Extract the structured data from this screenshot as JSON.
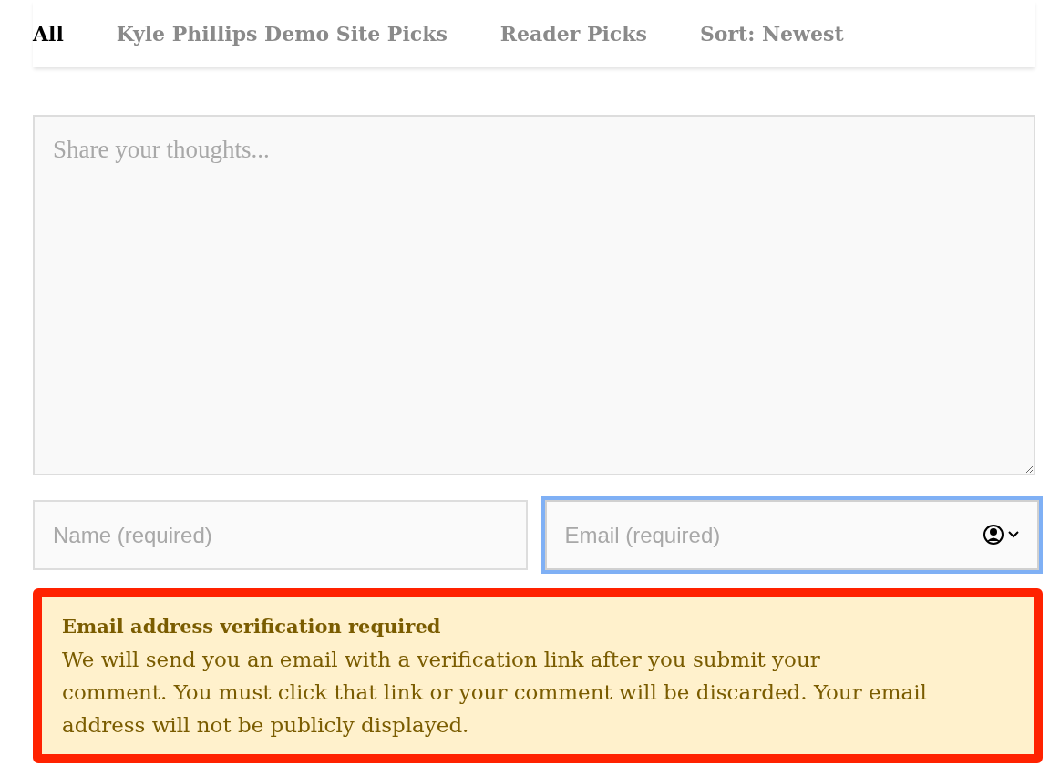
{
  "tabs": [
    {
      "label": "All",
      "selected": true
    },
    {
      "label": "Kyle Phillips Demo Site Picks",
      "selected": false
    },
    {
      "label": "Reader Picks",
      "selected": false
    },
    {
      "label": "Sort: Newest",
      "selected": false
    }
  ],
  "comment": {
    "placeholder": "Share your thoughts..."
  },
  "name_field": {
    "placeholder": "Name (required)",
    "focused": false
  },
  "email_field": {
    "placeholder": "Email (required)",
    "focused": true
  },
  "notice": {
    "title": "Email address verification required",
    "body": "We will send you an email with a verification link after you submit your comment. You must click that link or your comment will be discarded. Your email address will not be publicly displayed.",
    "highlighted": true
  }
}
